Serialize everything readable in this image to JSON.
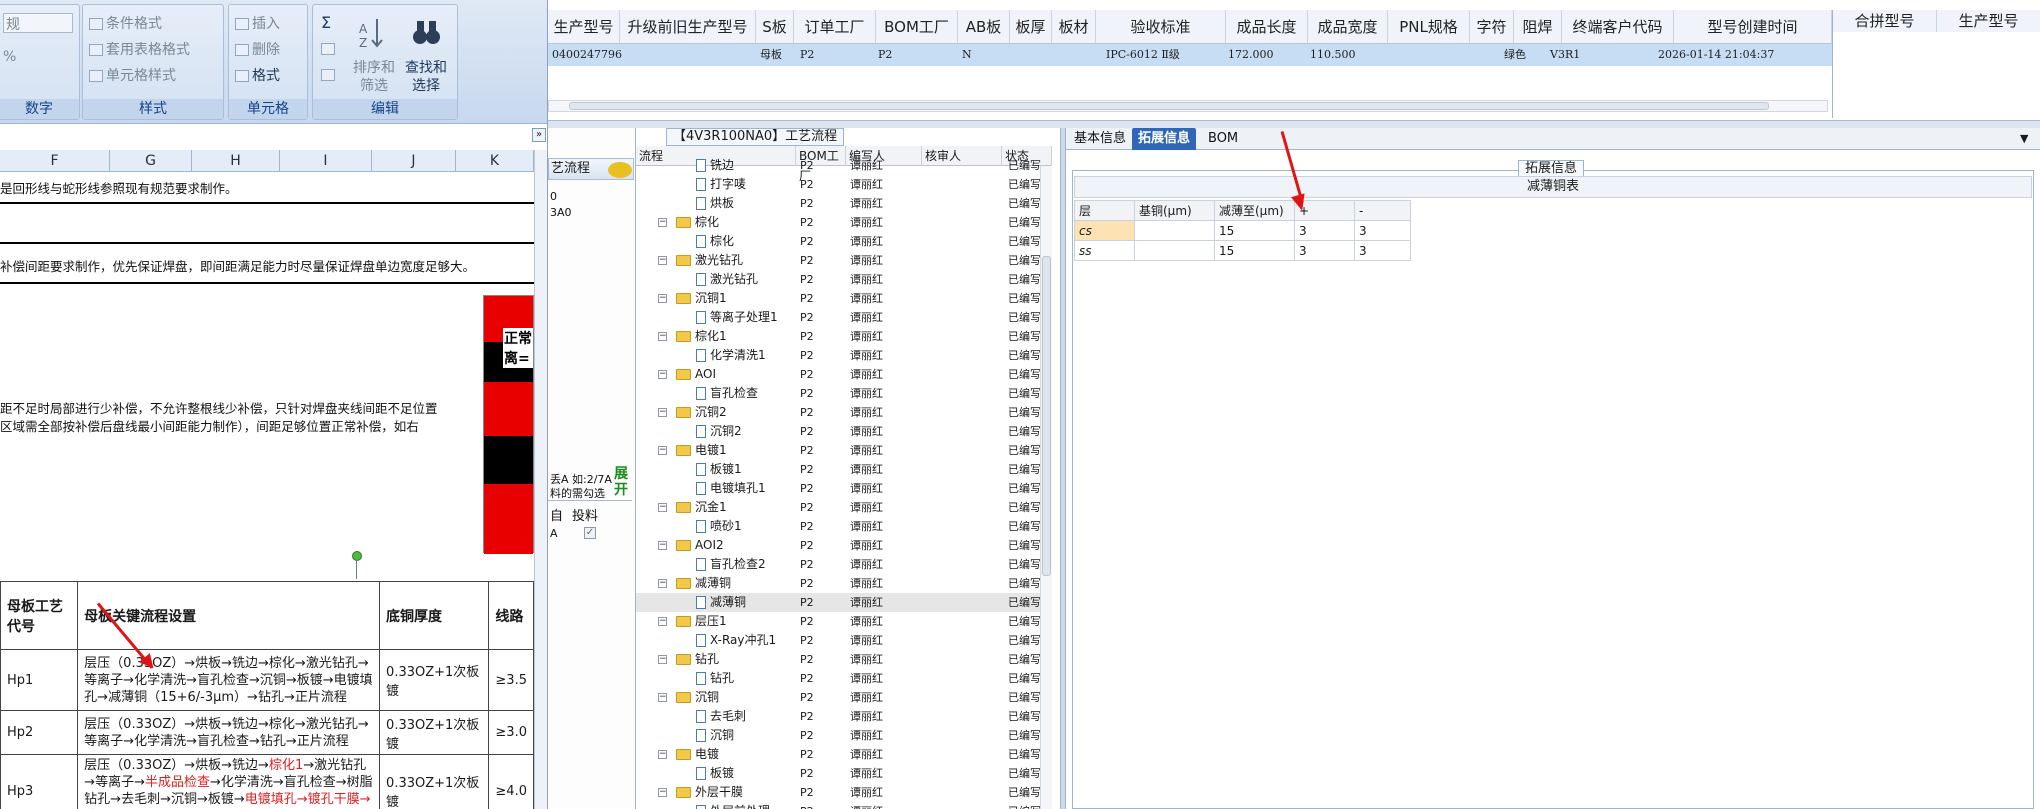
{
  "excel": {
    "ribbon": {
      "number_group": {
        "title": "数字",
        "format_value": "规",
        "percent": "%"
      },
      "styles_group": {
        "title": "样式",
        "conditional_format": "条件格式",
        "table_format": "套用表格格式",
        "cell_style": "单元格样式"
      },
      "cells_group": {
        "title": "单元格",
        "insert": "插入",
        "delete": "删除",
        "format": "格式"
      },
      "edit_group": {
        "title": "编辑",
        "sum": "Σ",
        "sort_filter_1": "排序和",
        "sort_filter_2": "筛选",
        "find_select_1": "查找和",
        "find_select_2": "选择"
      }
    },
    "collapse_glyph": "»",
    "columns": [
      "F",
      "G",
      "H",
      "I",
      "J",
      "K"
    ],
    "text_line_1": "是回形线与蛇形线参照现有规范要求制作。",
    "text_line_2": "补偿间距要求制作，优先保证焊盘，即间距满足能力时尽量保证焊盘单边宽度足够大。",
    "text_line_3": "距不足时局部进行少补偿，不允许整根线少补偿，只针对焊盘夹线间距不足位置",
    "text_line_4": "区域需全部按补偿后盘线最小间距能力制作），间距足够位置正常补偿，如右",
    "flag_label_1": "正常",
    "flag_label_2": "离=",
    "table": {
      "headers": [
        "母板工艺代号",
        "母板关键流程设置",
        "底铜厚度",
        "线路"
      ],
      "rows": [
        {
          "code": "Hp1",
          "process": "层压（0.33OZ）→烘板→铣边→棕化→激光钻孔→等离子→化学清洗→盲孔检查→沉铜→板镀→电镀填孔→减薄铜（15+6/-3μm）→钻孔→正片流程",
          "copper": "0.33OZ+1次板镀",
          "line": "≥3.5"
        },
        {
          "code": "Hp2",
          "process": "层压（0.33OZ）→烘板→铣边→棕化→激光钻孔→等离子→化学清洗→盲孔检查→钻孔→正片流程",
          "copper": "0.33OZ+1次板镀",
          "line": "≥3.0"
        },
        {
          "code": "Hp3",
          "process_a": "层压（0.33OZ）→烘板→铣边→",
          "process_red_1": "棕化1",
          "process_b": "→激光钻孔→等离子→",
          "process_red_2": "半成品检查",
          "process_c": "→化学清洗→盲孔检查→树脂钻孔→去毛刺→沉铜→板镀→",
          "process_red_3": "电镀填孔→镀孔干膜→镀",
          "copper": "0.33OZ+1次板镀",
          "line": "≥4.0"
        }
      ]
    }
  },
  "topgrid": {
    "headers": [
      "生产型号",
      "升级前旧生产型号",
      "S板",
      "订单工厂",
      "BOM工厂",
      "AB板",
      "板厚",
      "板材",
      "验收标准",
      "成品长度",
      "成品宽度",
      "PNL规格",
      "字符",
      "阻焊",
      "终端客户代码",
      "型号创建时间"
    ],
    "row": {
      "model": "0400247796",
      "sboard": "母板",
      "order_factory": "P2",
      "bom_factory": "P2",
      "ab": "N",
      "standard": "IPC-6012 Ⅱ级",
      "length": "172.000",
      "width": "110.500",
      "solder": "绿色",
      "customer": "V3R1",
      "created": "2026-01-14 21:04:37"
    },
    "right_headers": [
      "合拼型号",
      "生产型号"
    ]
  },
  "leftpanel": {
    "tab": "艺流程",
    "line1": "0",
    "line2": "3A0",
    "note_1": "丢A 如:2/7A",
    "note_2": "料的需勾选",
    "expand_1": "展",
    "expand_2": "开",
    "col1": "自",
    "col2": "投料",
    "row_val": "A"
  },
  "tree": {
    "title": "【4V3R100NA0】工艺流程",
    "headers": [
      "流程",
      "BOM工厂",
      "编写人",
      "核审人",
      "状态"
    ],
    "rows": [
      {
        "level": 1,
        "type": "doc",
        "name": "铣边",
        "factory": "P2",
        "author": "谭丽红",
        "status": "已编写"
      },
      {
        "level": 1,
        "type": "doc",
        "name": "打字唛",
        "factory": "P2",
        "author": "谭丽红",
        "status": "已编写"
      },
      {
        "level": 1,
        "type": "doc",
        "name": "烘板",
        "factory": "P2",
        "author": "谭丽红",
        "status": "已编写"
      },
      {
        "level": 0,
        "type": "folder",
        "name": "棕化",
        "factory": "P2",
        "author": "谭丽红",
        "status": "已编写"
      },
      {
        "level": 1,
        "type": "doc",
        "name": "棕化",
        "factory": "P2",
        "author": "谭丽红",
        "status": "已编写"
      },
      {
        "level": 0,
        "type": "folder",
        "name": "激光钻孔",
        "factory": "P2",
        "author": "谭丽红",
        "status": "已编写"
      },
      {
        "level": 1,
        "type": "doc",
        "name": "激光钻孔",
        "factory": "P2",
        "author": "谭丽红",
        "status": "已编写"
      },
      {
        "level": 0,
        "type": "folder",
        "name": "沉铜1",
        "factory": "P2",
        "author": "谭丽红",
        "status": "已编写"
      },
      {
        "level": 1,
        "type": "doc",
        "name": "等离子处理1",
        "factory": "P2",
        "author": "谭丽红",
        "status": "已编写"
      },
      {
        "level": 0,
        "type": "folder",
        "name": "棕化1",
        "factory": "P2",
        "author": "谭丽红",
        "status": "已编写"
      },
      {
        "level": 1,
        "type": "doc",
        "name": "化学清洗1",
        "factory": "P2",
        "author": "谭丽红",
        "status": "已编写"
      },
      {
        "level": 0,
        "type": "folder",
        "name": "AOI",
        "factory": "P2",
        "author": "谭丽红",
        "status": "已编写"
      },
      {
        "level": 1,
        "type": "doc",
        "name": "盲孔检查",
        "factory": "P2",
        "author": "谭丽红",
        "status": "已编写"
      },
      {
        "level": 0,
        "type": "folder",
        "name": "沉铜2",
        "factory": "P2",
        "author": "谭丽红",
        "status": "已编写"
      },
      {
        "level": 1,
        "type": "doc",
        "name": "沉铜2",
        "factory": "P2",
        "author": "谭丽红",
        "status": "已编写"
      },
      {
        "level": 0,
        "type": "folder",
        "name": "电镀1",
        "factory": "P2",
        "author": "谭丽红",
        "status": "已编写"
      },
      {
        "level": 1,
        "type": "doc",
        "name": "板镀1",
        "factory": "P2",
        "author": "谭丽红",
        "status": "已编写"
      },
      {
        "level": 1,
        "type": "doc",
        "name": "电镀填孔1",
        "factory": "P2",
        "author": "谭丽红",
        "status": "已编写"
      },
      {
        "level": 0,
        "type": "folder",
        "name": "沉金1",
        "factory": "P2",
        "author": "谭丽红",
        "status": "已编写"
      },
      {
        "level": 1,
        "type": "doc",
        "name": "喷砂1",
        "factory": "P2",
        "author": "谭丽红",
        "status": "已编写"
      },
      {
        "level": 0,
        "type": "folder",
        "name": "AOI2",
        "factory": "P2",
        "author": "谭丽红",
        "status": "已编写"
      },
      {
        "level": 1,
        "type": "doc",
        "name": "盲孔检查2",
        "factory": "P2",
        "author": "谭丽红",
        "status": "已编写"
      },
      {
        "level": 0,
        "type": "folder",
        "name": "减薄铜",
        "factory": "P2",
        "author": "谭丽红",
        "status": "已编写"
      },
      {
        "level": 1,
        "type": "doc",
        "name": "减薄铜",
        "factory": "P2",
        "author": "谭丽红",
        "status": "已编写",
        "selected": true
      },
      {
        "level": 0,
        "type": "folder",
        "name": "层压1",
        "factory": "P2",
        "author": "谭丽红",
        "status": "已编写"
      },
      {
        "level": 1,
        "type": "doc",
        "name": "X-Ray冲孔1",
        "factory": "P2",
        "author": "谭丽红",
        "status": "已编写"
      },
      {
        "level": 0,
        "type": "folder",
        "name": "钻孔",
        "factory": "P2",
        "author": "谭丽红",
        "status": "已编写"
      },
      {
        "level": 1,
        "type": "doc",
        "name": "钻孔",
        "factory": "P2",
        "author": "谭丽红",
        "status": "已编写"
      },
      {
        "level": 0,
        "type": "folder",
        "name": "沉铜",
        "factory": "P2",
        "author": "谭丽红",
        "status": "已编写"
      },
      {
        "level": 1,
        "type": "doc",
        "name": "去毛刺",
        "factory": "P2",
        "author": "谭丽红",
        "status": "已编写"
      },
      {
        "level": 1,
        "type": "doc",
        "name": "沉铜",
        "factory": "P2",
        "author": "谭丽红",
        "status": "已编写"
      },
      {
        "level": 0,
        "type": "folder",
        "name": "电镀",
        "factory": "P2",
        "author": "谭丽红",
        "status": "已编写"
      },
      {
        "level": 1,
        "type": "doc",
        "name": "板镀",
        "factory": "P2",
        "author": "谭丽红",
        "status": "已编写"
      },
      {
        "level": 0,
        "type": "folder",
        "name": "外层干膜",
        "factory": "P2",
        "author": "谭丽红",
        "status": "已编写"
      },
      {
        "level": 1,
        "type": "doc",
        "name": "外层前处理",
        "factory": "P2",
        "author": "谭丽红",
        "status": "已编写"
      }
    ]
  },
  "detail": {
    "tabs": [
      "基本信息",
      "拓展信息",
      "BOM"
    ],
    "active_tab": 1,
    "group_title": "拓展信息",
    "table_caption": "减薄铜表",
    "table_headers": [
      "层",
      "基铜(μm)",
      "减薄至(μm)",
      "+",
      "-"
    ],
    "table_rows": [
      {
        "layer": "cs",
        "base": "",
        "thin_to": "15",
        "plus": "3",
        "minus": "3"
      },
      {
        "layer": "ss",
        "base": "",
        "thin_to": "15",
        "plus": "3",
        "minus": "3"
      }
    ],
    "dropdown_arrow": "▼"
  },
  "colors": {
    "accent": "#2f67b6",
    "selected_row": "#c7ddf3",
    "arrow": "#e01414",
    "highlight_cell": "#fde3b3"
  }
}
